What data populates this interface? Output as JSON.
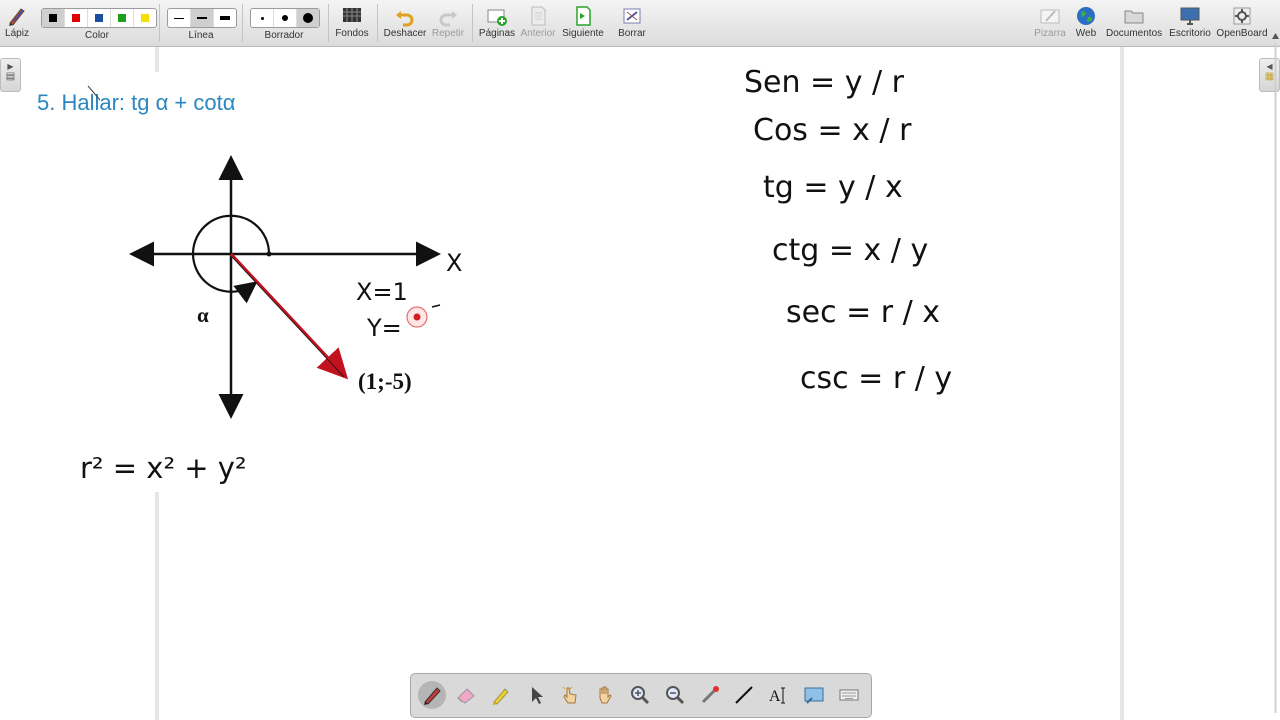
{
  "toolbar": {
    "pencil": "Lápiz",
    "color": "Color",
    "line": "Línea",
    "eraser": "Borrador",
    "backgrounds": "Fondos",
    "undo": "Deshacer",
    "redo": "Repetir",
    "pages": "Páginas",
    "previous": "Anterior",
    "next": "Siguiente",
    "clear": "Borrar",
    "whiteboard": "Pizarra",
    "web": "Web",
    "documents": "Documentos",
    "desktop": "Escritorio",
    "openboard": "OpenBoard",
    "colors": [
      "#000000",
      "#e00000",
      "#1a4fa0",
      "#1f9e1f",
      "#f2e000"
    ]
  },
  "board": {
    "title": "5.  Hallar:  tg α + cotα",
    "alpha": "α",
    "point": "(1;-5)",
    "axis_x": "X",
    "hand_x": "X=1",
    "hand_y": "Y=",
    "pythagoras": "r² = x² + y²",
    "formulas": [
      "Sen = y / r",
      "Cos = x / r",
      "tg = y / x",
      "ctg = x / y",
      "sec = r / x",
      "csc = r / y"
    ]
  },
  "colors": {
    "title": "#2b87bf",
    "vector": "#c0121f",
    "ink": "#111111"
  }
}
